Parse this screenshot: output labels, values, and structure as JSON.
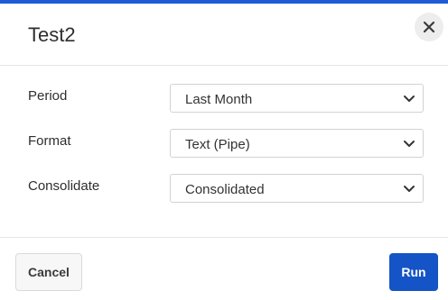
{
  "dialog": {
    "title": "Test2",
    "accent_color": "#1f5bd6"
  },
  "fields": [
    {
      "label": "Period",
      "value": "Last Month"
    },
    {
      "label": "Format",
      "value": "Text (Pipe)"
    },
    {
      "label": "Consolidate",
      "value": "Consolidated"
    }
  ],
  "footer": {
    "cancel_label": "Cancel",
    "run_label": "Run",
    "run_color": "#1554c6"
  },
  "icons": {
    "close": "close-icon",
    "dropdown": "chevron-down-icon"
  }
}
